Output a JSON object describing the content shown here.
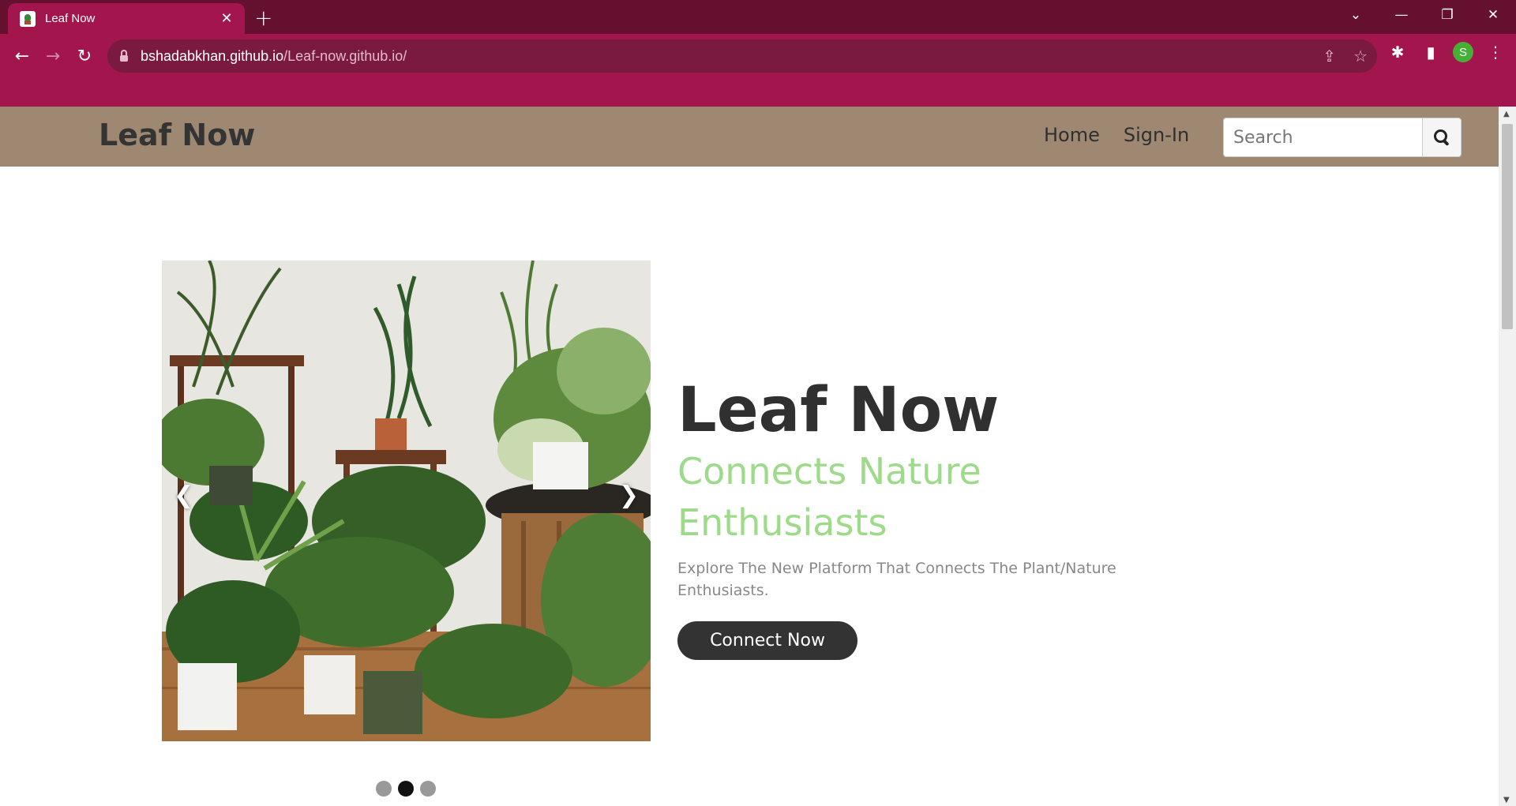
{
  "browser": {
    "tab_title": "Leaf Now",
    "url_domain": "bshadabkhan.github.io",
    "url_path": "/Leaf-now.github.io/",
    "profile_initial": "S",
    "theme_color": "#a2154d"
  },
  "site": {
    "brand": "Leaf Now",
    "nav_links": [
      "Home",
      "Sign-In"
    ],
    "search_placeholder": "Search",
    "nav_color": "#9f8872"
  },
  "hero": {
    "title": "Leaf Now",
    "subtitle": "Connects Nature Enthusiasts",
    "description": "Explore The New Platform That Connects The Plant/Nature Enthusiasts.",
    "cta_label": "Connect Now",
    "subtitle_color": "#9ddb8a"
  },
  "carousel": {
    "prev_glyph": "❮",
    "next_glyph": "❯",
    "slide_count": 3,
    "active_slide": 2
  }
}
